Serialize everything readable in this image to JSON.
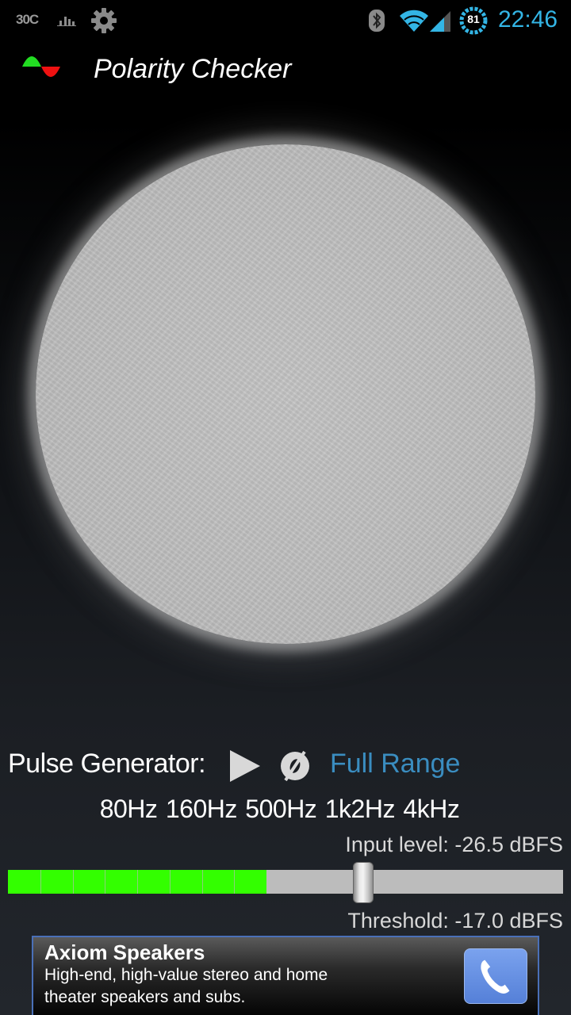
{
  "status_bar": {
    "temperature": "30C",
    "battery_percent": "81",
    "time": "22:46",
    "icons": [
      "temperature-icon",
      "chart-icon",
      "gear-icon",
      "bluetooth-icon",
      "wifi-icon",
      "signal-icon",
      "battery-icon"
    ]
  },
  "action_bar": {
    "title": "Polarity Checker",
    "logo_icon": "polarity-sine-wave-icon",
    "logo_colors": {
      "positive": "#22dd22",
      "negative": "#ee1111"
    }
  },
  "speaker": {
    "icon": "speaker-cone"
  },
  "pulse_generator": {
    "label": "Pulse Generator:",
    "play_icon": "play-icon",
    "phase_icon": "phase-invert-icon",
    "range": "Full Range",
    "frequencies": [
      "80Hz",
      "160Hz",
      "500Hz",
      "1k2Hz",
      "4kHz"
    ]
  },
  "meter": {
    "input_level_label": "Input level: -26.5 dBFS",
    "threshold_label": "Threshold: -17.0 dBFS",
    "input_fraction": 0.466,
    "threshold_fraction": 0.64,
    "segments": 8,
    "fill_color": "#33ff00",
    "track_color": "#bcbcbc"
  },
  "ad": {
    "title": "Axiom Speakers",
    "line1": "High-end, high-value stereo and home",
    "line2": "theater speakers and subs.",
    "call_icon": "phone-icon",
    "border_color": "#4a70b8"
  }
}
